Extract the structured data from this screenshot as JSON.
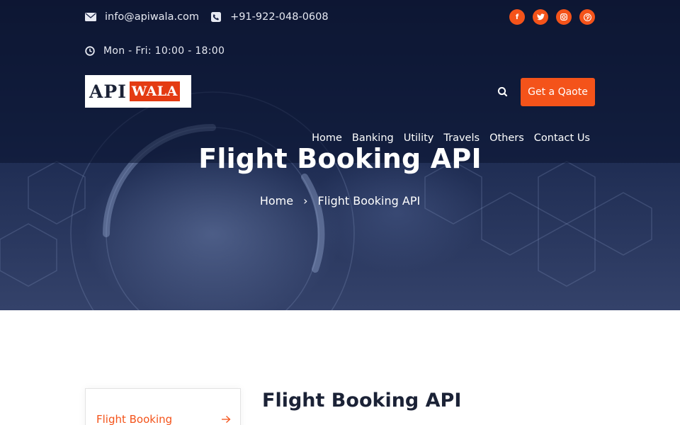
{
  "topbar": {
    "email": "info@apiwala.com",
    "phone": "+91-922-048-0608",
    "hours": "Mon - Fri: 10:00 - 18:00",
    "email_icon": "envelope-icon",
    "phone_icon": "phone-icon",
    "hours_icon": "clock-icon"
  },
  "socials": [
    {
      "name": "facebook-icon",
      "glyph": "f"
    },
    {
      "name": "twitter-icon",
      "glyph": "t"
    },
    {
      "name": "instagram-icon",
      "glyph": "◎"
    },
    {
      "name": "pinterest-icon",
      "glyph": "p"
    }
  ],
  "logo": {
    "part1": "API",
    "part2": "WALA"
  },
  "header": {
    "quote_label": "Get a Qaote",
    "search_icon": "search-icon"
  },
  "nav": [
    "Home",
    "Banking",
    "Utility",
    "Travels",
    "Others",
    "Contact Us"
  ],
  "hero": {
    "title": "Flight Booking API",
    "breadcrumb": {
      "home": "Home",
      "separator": "›",
      "current": "Flight Booking API"
    }
  },
  "sidebar": {
    "active_item": "Flight Booking",
    "arrow_icon": "arrow-right-icon"
  },
  "main": {
    "title": "Flight Booking API"
  },
  "colors": {
    "accent": "#f4531a",
    "dark": "#1b2236",
    "hero": "#1c2a50"
  }
}
